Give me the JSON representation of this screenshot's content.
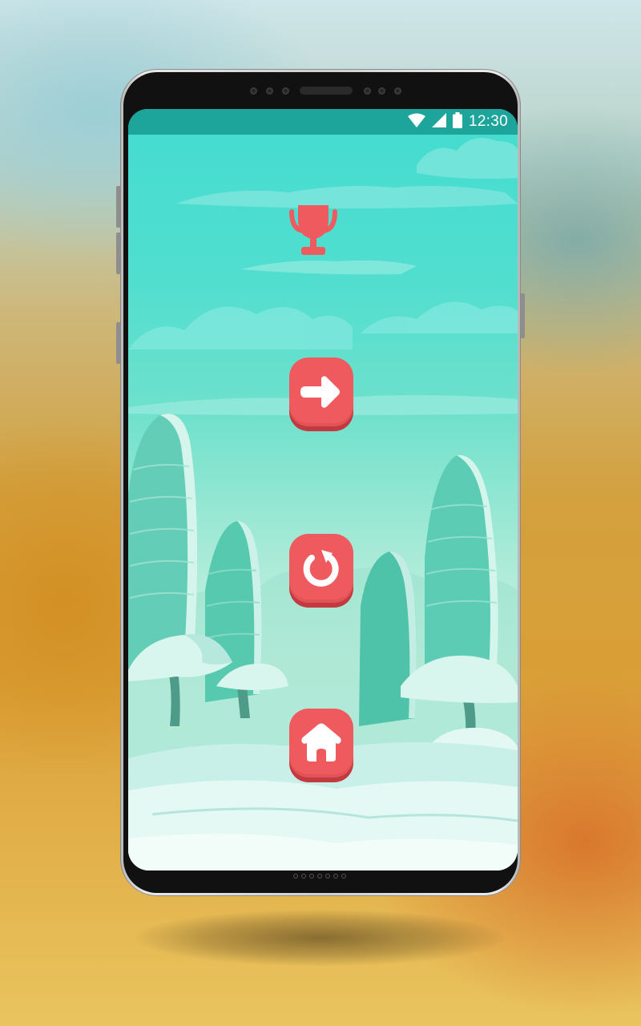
{
  "status_bar": {
    "time": "12:30",
    "icons": [
      "wifi-icon",
      "cellular-signal-icon",
      "battery-icon"
    ]
  },
  "game_menu": {
    "trophy_icon": "trophy-icon",
    "buttons": [
      {
        "name": "next-button",
        "icon": "arrow-right-icon"
      },
      {
        "name": "restart-button",
        "icon": "restart-icon"
      },
      {
        "name": "home-button",
        "icon": "home-icon"
      }
    ]
  },
  "colors": {
    "accent": "#ee5a5d",
    "accent_shadow": "#c4383f",
    "status_bar": "#1ea59b",
    "sky": "#44dcd0"
  }
}
